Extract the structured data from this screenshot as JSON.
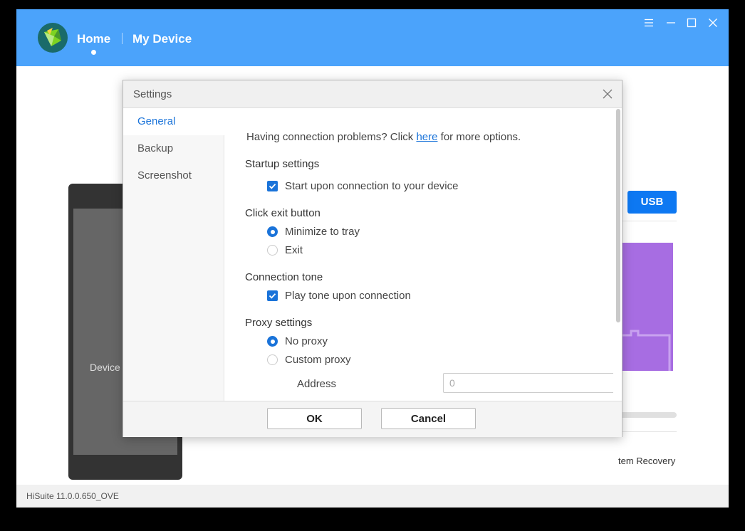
{
  "app": {
    "nav": {
      "home": "Home",
      "my_device": "My Device"
    },
    "version": "HiSuite 11.0.0.650_OVE"
  },
  "background": {
    "device_label": "Device",
    "usb_label": "USB",
    "recovery_label": "tem Recovery"
  },
  "dialog": {
    "title": "Settings",
    "sidebar": [
      {
        "label": "General",
        "active": true
      },
      {
        "label": "Backup",
        "active": false
      },
      {
        "label": "Screenshot",
        "active": false
      }
    ],
    "general": {
      "help_prefix": "Having connection problems? Click ",
      "help_link": "here",
      "help_suffix": " for more options.",
      "startup": {
        "title": "Startup settings",
        "start_on_connect": {
          "label": "Start upon connection to your device",
          "checked": true
        }
      },
      "exit_button": {
        "title": "Click exit button",
        "minimize": {
          "label": "Minimize to tray",
          "selected": true
        },
        "exit": {
          "label": "Exit",
          "selected": false
        }
      },
      "tone": {
        "title": "Connection tone",
        "play_tone": {
          "label": "Play tone upon connection",
          "checked": true
        }
      },
      "proxy": {
        "title": "Proxy settings",
        "no_proxy": {
          "label": "No proxy",
          "selected": true
        },
        "custom_proxy": {
          "label": "Custom proxy",
          "selected": false
        },
        "address_label": "Address",
        "address_placeholder": "0"
      }
    },
    "ok": "OK",
    "cancel": "Cancel"
  },
  "colors": {
    "titlebar": "#4ba3fb",
    "accent": "#1a73d9",
    "usb_button": "#0d78f2",
    "purple_card": "#a76de2"
  }
}
